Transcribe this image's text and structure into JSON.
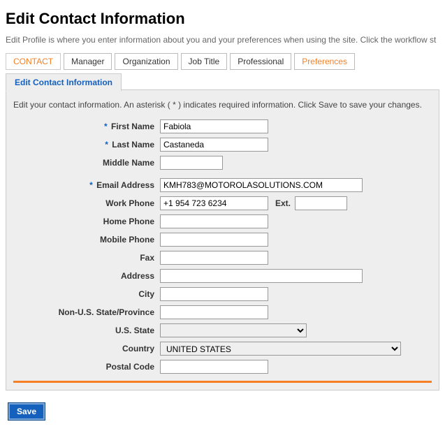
{
  "page": {
    "title": "Edit Contact Information",
    "intro": "Edit Profile is where you enter information about you and your preferences when using the site. Click the workflow st"
  },
  "outerTabs": {
    "contact": "CONTACT",
    "manager": "Manager",
    "organization": "Organization",
    "jobTitle": "Job Title",
    "professional": "Professional",
    "preferences": "Preferences"
  },
  "innerTab": "Edit Contact Information",
  "panelDesc": "Edit your contact information. An asterisk ( * ) indicates required information. Click Save to save your changes.",
  "labels": {
    "firstName": "First Name",
    "lastName": "Last Name",
    "middleName": "Middle Name",
    "email": "Email Address",
    "workPhone": "Work Phone",
    "ext": "Ext.",
    "homePhone": "Home Phone",
    "mobilePhone": "Mobile Phone",
    "fax": "Fax",
    "address": "Address",
    "city": "City",
    "nonUsState": "Non-U.S. State/Province",
    "usState": "U.S. State",
    "country": "Country",
    "postalCode": "Postal Code"
  },
  "values": {
    "firstName": "Fabiola",
    "lastName": "Castaneda",
    "middleName": "",
    "email": "KMH783@MOTOROLASOLUTIONS.COM",
    "workPhone": "+1 954 723 6234",
    "ext": "",
    "homePhone": "",
    "mobilePhone": "",
    "fax": "",
    "address": "",
    "city": "",
    "nonUsState": "",
    "usState": "",
    "country": "UNITED STATES",
    "postalCode": ""
  },
  "buttons": {
    "save": "Save"
  },
  "reqMark": "*"
}
